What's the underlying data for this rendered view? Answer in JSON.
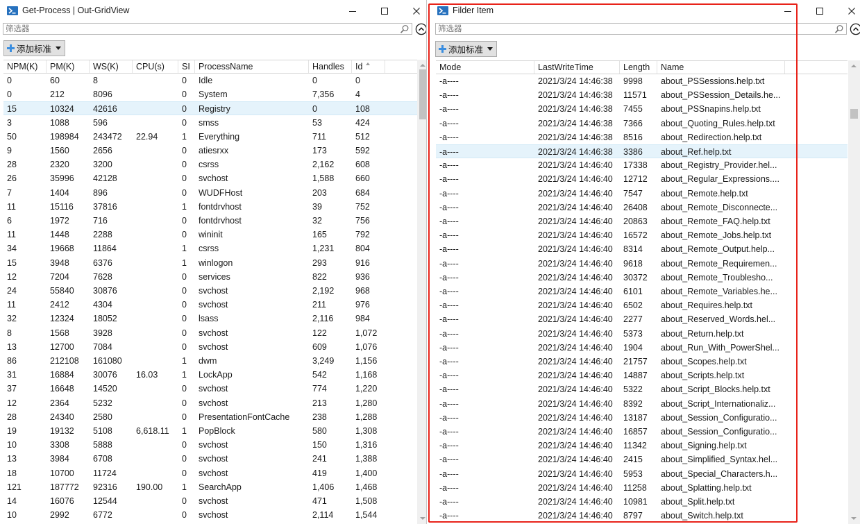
{
  "left_window": {
    "title": "Get-Process | Out-GridView",
    "filter_placeholder": "筛选器",
    "add_criteria_label": "添加标准",
    "columns": [
      "NPM(K)",
      "PM(K)",
      "WS(K)",
      "CPU(s)",
      "SI",
      "ProcessName",
      "Handles",
      "Id"
    ],
    "sorted_column": "Id",
    "selected_row_index": 2,
    "rows": [
      [
        "0",
        "60",
        "8",
        "",
        "0",
        "Idle",
        "0",
        "0"
      ],
      [
        "0",
        "212",
        "8096",
        "",
        "0",
        "System",
        "7,356",
        "4"
      ],
      [
        "15",
        "10324",
        "42616",
        "",
        "0",
        "Registry",
        "0",
        "108"
      ],
      [
        "3",
        "1088",
        "596",
        "",
        "0",
        "smss",
        "53",
        "424"
      ],
      [
        "50",
        "198984",
        "243472",
        "22.94",
        "1",
        "Everything",
        "711",
        "512"
      ],
      [
        "9",
        "1560",
        "2656",
        "",
        "0",
        "atiesrxx",
        "173",
        "592"
      ],
      [
        "28",
        "2320",
        "3200",
        "",
        "0",
        "csrss",
        "2,162",
        "608"
      ],
      [
        "26",
        "35996",
        "42128",
        "",
        "0",
        "svchost",
        "1,588",
        "660"
      ],
      [
        "7",
        "1404",
        "896",
        "",
        "0",
        "WUDFHost",
        "203",
        "684"
      ],
      [
        "11",
        "15116",
        "37816",
        "",
        "1",
        "fontdrvhost",
        "39",
        "752"
      ],
      [
        "6",
        "1972",
        "716",
        "",
        "0",
        "fontdrvhost",
        "32",
        "756"
      ],
      [
        "11",
        "1448",
        "2288",
        "",
        "0",
        "wininit",
        "165",
        "792"
      ],
      [
        "34",
        "19668",
        "11864",
        "",
        "1",
        "csrss",
        "1,231",
        "804"
      ],
      [
        "15",
        "3948",
        "6376",
        "",
        "1",
        "winlogon",
        "293",
        "916"
      ],
      [
        "12",
        "7204",
        "7628",
        "",
        "0",
        "services",
        "822",
        "936"
      ],
      [
        "24",
        "55840",
        "30876",
        "",
        "0",
        "svchost",
        "2,192",
        "968"
      ],
      [
        "11",
        "2412",
        "4304",
        "",
        "0",
        "svchost",
        "211",
        "976"
      ],
      [
        "32",
        "12324",
        "18052",
        "",
        "0",
        "lsass",
        "2,116",
        "984"
      ],
      [
        "8",
        "1568",
        "3928",
        "",
        "0",
        "svchost",
        "122",
        "1,072"
      ],
      [
        "13",
        "12700",
        "7084",
        "",
        "0",
        "svchost",
        "609",
        "1,076"
      ],
      [
        "86",
        "212108",
        "161080",
        "",
        "1",
        "dwm",
        "3,249",
        "1,156"
      ],
      [
        "31",
        "16884",
        "30076",
        "16.03",
        "1",
        "LockApp",
        "542",
        "1,168"
      ],
      [
        "37",
        "16648",
        "14520",
        "",
        "0",
        "svchost",
        "774",
        "1,220"
      ],
      [
        "12",
        "2364",
        "5232",
        "",
        "0",
        "svchost",
        "213",
        "1,280"
      ],
      [
        "28",
        "24340",
        "2580",
        "",
        "0",
        "PresentationFontCache",
        "238",
        "1,288"
      ],
      [
        "19",
        "19132",
        "5108",
        "6,618.11",
        "1",
        "PopBlock",
        "580",
        "1,308"
      ],
      [
        "10",
        "3308",
        "5888",
        "",
        "0",
        "svchost",
        "150",
        "1,316"
      ],
      [
        "13",
        "3984",
        "6708",
        "",
        "0",
        "svchost",
        "241",
        "1,388"
      ],
      [
        "18",
        "10700",
        "11724",
        "",
        "0",
        "svchost",
        "419",
        "1,400"
      ],
      [
        "121",
        "187772",
        "92316",
        "190.00",
        "1",
        "SearchApp",
        "1,406",
        "1,468"
      ],
      [
        "14",
        "16076",
        "12544",
        "",
        "0",
        "svchost",
        "471",
        "1,508"
      ],
      [
        "10",
        "2992",
        "6772",
        "",
        "0",
        "svchost",
        "2,114",
        "1,544"
      ]
    ]
  },
  "right_window": {
    "title": "Filder Item",
    "filter_placeholder": "筛选器",
    "add_criteria_label": "添加标准",
    "columns": [
      "Mode",
      "LastWriteTime",
      "Length",
      "Name"
    ],
    "selected_row_index": 5,
    "highlight_color": "#e8231a",
    "rows": [
      [
        "-a----",
        "2021/3/24 14:46:38",
        "9998",
        "about_PSSessions.help.txt"
      ],
      [
        "-a----",
        "2021/3/24 14:46:38",
        "11571",
        "about_PSSession_Details.he..."
      ],
      [
        "-a----",
        "2021/3/24 14:46:38",
        "7455",
        "about_PSSnapins.help.txt"
      ],
      [
        "-a----",
        "2021/3/24 14:46:38",
        "7366",
        "about_Quoting_Rules.help.txt"
      ],
      [
        "-a----",
        "2021/3/24 14:46:38",
        "8516",
        "about_Redirection.help.txt"
      ],
      [
        "-a----",
        "2021/3/24 14:46:38",
        "3386",
        "about_Ref.help.txt"
      ],
      [
        "-a----",
        "2021/3/24 14:46:40",
        "17338",
        "about_Registry_Provider.hel..."
      ],
      [
        "-a----",
        "2021/3/24 14:46:40",
        "12712",
        "about_Regular_Expressions...."
      ],
      [
        "-a----",
        "2021/3/24 14:46:40",
        "7547",
        "about_Remote.help.txt"
      ],
      [
        "-a----",
        "2021/3/24 14:46:40",
        "26408",
        "about_Remote_Disconnecte..."
      ],
      [
        "-a----",
        "2021/3/24 14:46:40",
        "20863",
        "about_Remote_FAQ.help.txt"
      ],
      [
        "-a----",
        "2021/3/24 14:46:40",
        "16572",
        "about_Remote_Jobs.help.txt"
      ],
      [
        "-a----",
        "2021/3/24 14:46:40",
        "8314",
        "about_Remote_Output.help..."
      ],
      [
        "-a----",
        "2021/3/24 14:46:40",
        "9618",
        "about_Remote_Requiremen..."
      ],
      [
        "-a----",
        "2021/3/24 14:46:40",
        "30372",
        "about_Remote_Troublesho..."
      ],
      [
        "-a----",
        "2021/3/24 14:46:40",
        "6101",
        "about_Remote_Variables.he..."
      ],
      [
        "-a----",
        "2021/3/24 14:46:40",
        "6502",
        "about_Requires.help.txt"
      ],
      [
        "-a----",
        "2021/3/24 14:46:40",
        "2277",
        "about_Reserved_Words.hel..."
      ],
      [
        "-a----",
        "2021/3/24 14:46:40",
        "5373",
        "about_Return.help.txt"
      ],
      [
        "-a----",
        "2021/3/24 14:46:40",
        "1904",
        "about_Run_With_PowerShel..."
      ],
      [
        "-a----",
        "2021/3/24 14:46:40",
        "21757",
        "about_Scopes.help.txt"
      ],
      [
        "-a----",
        "2021/3/24 14:46:40",
        "14887",
        "about_Scripts.help.txt"
      ],
      [
        "-a----",
        "2021/3/24 14:46:40",
        "5322",
        "about_Script_Blocks.help.txt"
      ],
      [
        "-a----",
        "2021/3/24 14:46:40",
        "8392",
        "about_Script_Internationaliz..."
      ],
      [
        "-a----",
        "2021/3/24 14:46:40",
        "13187",
        "about_Session_Configuratio..."
      ],
      [
        "-a----",
        "2021/3/24 14:46:40",
        "16857",
        "about_Session_Configuratio..."
      ],
      [
        "-a----",
        "2021/3/24 14:46:40",
        "11342",
        "about_Signing.help.txt"
      ],
      [
        "-a----",
        "2021/3/24 14:46:40",
        "2415",
        "about_Simplified_Syntax.hel..."
      ],
      [
        "-a----",
        "2021/3/24 14:46:40",
        "5953",
        "about_Special_Characters.h..."
      ],
      [
        "-a----",
        "2021/3/24 14:46:40",
        "11258",
        "about_Splatting.help.txt"
      ],
      [
        "-a----",
        "2021/3/24 14:46:40",
        "10981",
        "about_Split.help.txt"
      ],
      [
        "-a----",
        "2021/3/24 14:46:40",
        "8797",
        "about_Switch.help.txt"
      ]
    ]
  }
}
